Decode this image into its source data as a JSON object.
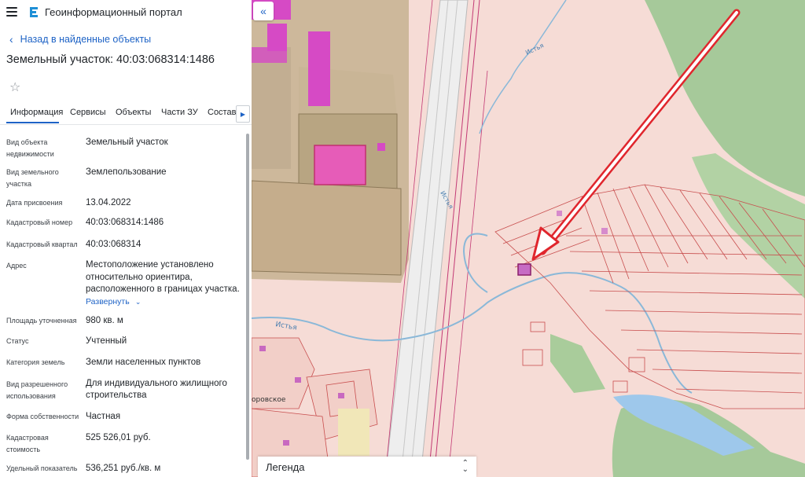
{
  "app": {
    "title": "Геоинформационный портал"
  },
  "nav": {
    "back_label": "Назад в найденные объекты"
  },
  "object": {
    "title": "Земельный участок: 40:03:068314:1486"
  },
  "tabs": [
    {
      "label": "Информация"
    },
    {
      "label": "Сервисы"
    },
    {
      "label": "Объекты"
    },
    {
      "label": "Части ЗУ"
    },
    {
      "label": "Состав"
    }
  ],
  "attributes": {
    "object_type": {
      "label": "Вид объекта недвижимости",
      "value": "Земельный участок"
    },
    "land_type": {
      "label": "Вид земельного участка",
      "value": "Землепользование"
    },
    "assigned_date": {
      "label": "Дата присвоения",
      "value": "13.04.2022"
    },
    "cadastral_number": {
      "label": "Кадастровый номер",
      "value": "40:03:068314:1486"
    },
    "cadastral_block": {
      "label": "Кадастровый квартал",
      "value": "40:03:068314"
    },
    "address": {
      "label": "Адрес",
      "value": "Местоположение установлено относительно ориентира, расположенного в границах участка.",
      "expand_label": "Развернуть"
    },
    "area": {
      "label": "Площадь уточненная",
      "value": "980 кв. м"
    },
    "status": {
      "label": "Статус",
      "value": "Учтенный"
    },
    "land_category": {
      "label": "Категория земель",
      "value": "Земли населенных пунктов"
    },
    "permitted_use": {
      "label": "Вид разрешенного использования",
      "value": "Для индивидуального жилищного строительства"
    },
    "ownership": {
      "label": "Форма собственности",
      "value": "Частная"
    },
    "cadastral_value": {
      "label": "Кадастровая стоимость",
      "value": "525 526,01 руб."
    },
    "unit_value": {
      "label": "Удельный показатель",
      "value": "536,251 руб./кв. м"
    }
  },
  "map": {
    "legend_label": "Легенда",
    "labels": {
      "river1": "Истья",
      "river2": "Истья",
      "road1": "Истья",
      "settlement": "оровское"
    }
  },
  "colors": {
    "accent": "#1e63c6",
    "arrow": "#e0262d",
    "parcel": "#c0306f",
    "land": "#f6dcd6",
    "forest": "#a6c99a"
  }
}
